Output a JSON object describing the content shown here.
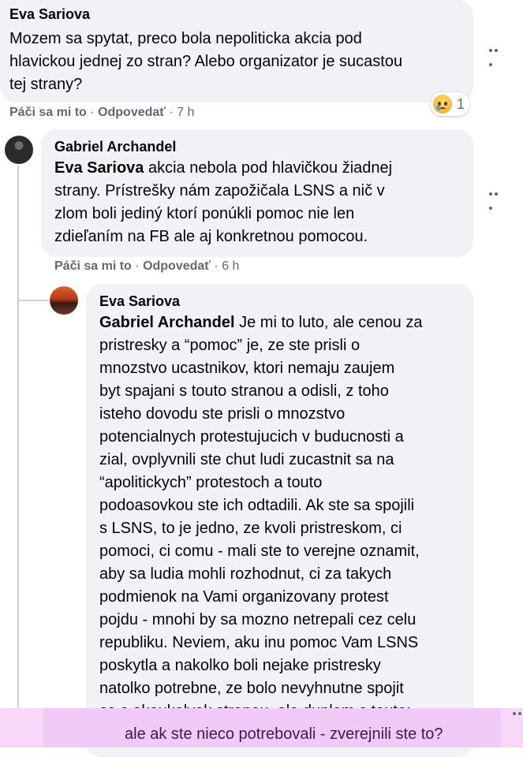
{
  "comments": [
    {
      "author": "Eva Sariova",
      "text": "Mozem sa spytat, preco bola nepoliticka akcia pod hlavickou jednej zo strán? Alebo organizator je sucastou tej strany?",
      "lines": [
        "Mozem sa spytat, preco bola nepoliticka akcia pod",
        "hlavickou jednej zo stran? Alebo organizator je sucastou",
        "tej strany?"
      ],
      "like_label": "Páči sa mi to",
      "reply_label": "Odpovedať",
      "time": "7 h",
      "reaction": {
        "icon": "sad-tear-emoji",
        "count": "1"
      }
    },
    {
      "author": "Gabriel Archandel",
      "mention": "Eva Sariova",
      "lines": [
        " akcia nebola pod hlavičkou žiadnej",
        "strany. Prístrešky nám zapožičala LSNS a nič v",
        "zlom boli jediný ktorí ponúkli pomoc nie len",
        "zdieľaním na FB ale aj konkretnou pomocou."
      ],
      "like_label": "Páči sa mi to",
      "reply_label": "Odpovedať",
      "time": "6 h"
    },
    {
      "author": "Eva Sariova",
      "mention": "Gabriel Archandel",
      "lines": [
        " Je mi to luto, ale cenou za",
        "pristresky a “pomoc” je, ze ste prisli o",
        "mnozstvo ucastnikov, ktori nemaju zaujem",
        "byt spajani s touto stranou a odisli, z toho",
        "isteho dovodu ste prisli o mnozstvo",
        "potencialnych protestujucich v buducnosti a",
        "zial, ovplyvnili ste chut ludi zucastnit sa na",
        "“apolitickych” protestoch a touto",
        "podoasovkou ste ich odtadili. Ak ste sa spojili",
        "s LSNS, to je jedno, ze kvoli pristreskom, ci",
        "pomoci, ci comu - mali ste to verejne oznamit,",
        "aby sa ludia mohli rozhodnut, ci za takych",
        "podmienok na Vami organizovany protest",
        "pojdu - mnohi by sa mozno netrepali cez celu",
        "republiku. Neviem, aku inu pomoc Vam LSNS",
        "poskytla a nakolko boli nejake pristresky",
        "natolko potrebne, ze bolo nevyhnutne spojit",
        "sa s akoukolvek stranou, ale duplom s touto;"
      ]
    }
  ],
  "overlay_line": "ale ak ste nieco potrebovali - zverejnili ste to?",
  "colors": {
    "bubble": "#f0f2f5",
    "meta": "#65676b",
    "overlay": "#f2caf7"
  }
}
